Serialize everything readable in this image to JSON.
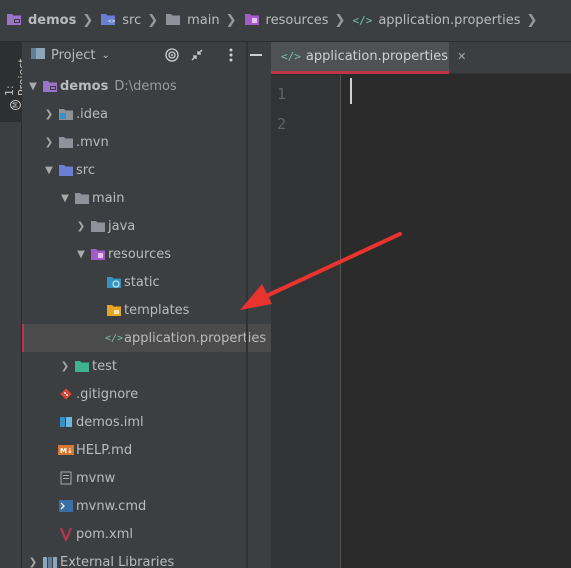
{
  "breadcrumb": {
    "items": [
      {
        "label": "demos",
        "icon": "project-folder-icon"
      },
      {
        "label": "src",
        "icon": "source-folder-icon"
      },
      {
        "label": "main",
        "icon": "folder-icon"
      },
      {
        "label": "resources",
        "icon": "resources-folder-icon"
      },
      {
        "label": "application.properties",
        "icon": "properties-file-icon"
      }
    ]
  },
  "tool_strip": {
    "label": "1: Project"
  },
  "project_panel": {
    "title": "Project",
    "tree": [
      {
        "label": "demos",
        "path": "D:\\demos",
        "icon": "project-folder-icon",
        "expanded": true
      },
      {
        "label": ".idea",
        "icon": "idea-folder-icon",
        "expanded": false
      },
      {
        "label": ".mvn",
        "icon": "folder-icon",
        "expanded": false
      },
      {
        "label": "src",
        "icon": "source-folder-icon",
        "expanded": true
      },
      {
        "label": "main",
        "icon": "folder-icon",
        "expanded": true
      },
      {
        "label": "java",
        "icon": "folder-icon",
        "expanded": false
      },
      {
        "label": "resources",
        "icon": "resources-folder-icon",
        "expanded": true
      },
      {
        "label": "static",
        "icon": "web-folder-icon"
      },
      {
        "label": "templates",
        "icon": "templates-folder-icon"
      },
      {
        "label": "application.properties",
        "icon": "properties-file-icon",
        "selected": true
      },
      {
        "label": "test",
        "icon": "test-folder-icon",
        "expanded": false
      },
      {
        "label": ".gitignore",
        "icon": "git-icon"
      },
      {
        "label": "demos.iml",
        "icon": "iml-file-icon"
      },
      {
        "label": "HELP.md",
        "icon": "markdown-file-icon"
      },
      {
        "label": "mvnw",
        "icon": "text-file-icon"
      },
      {
        "label": "mvnw.cmd",
        "icon": "cmd-file-icon"
      },
      {
        "label": "pom.xml",
        "icon": "maven-icon"
      },
      {
        "label": "External Libraries",
        "icon": "libraries-icon",
        "expanded": false
      }
    ]
  },
  "editor": {
    "tab_label": "application.properties",
    "line_numbers": [
      "1",
      "2"
    ]
  },
  "colors": {
    "accent": "#c0354a",
    "annotation_arrow": "#e8332e",
    "panel_bg": "#3c3f41",
    "editor_bg": "#2b2b2b"
  }
}
